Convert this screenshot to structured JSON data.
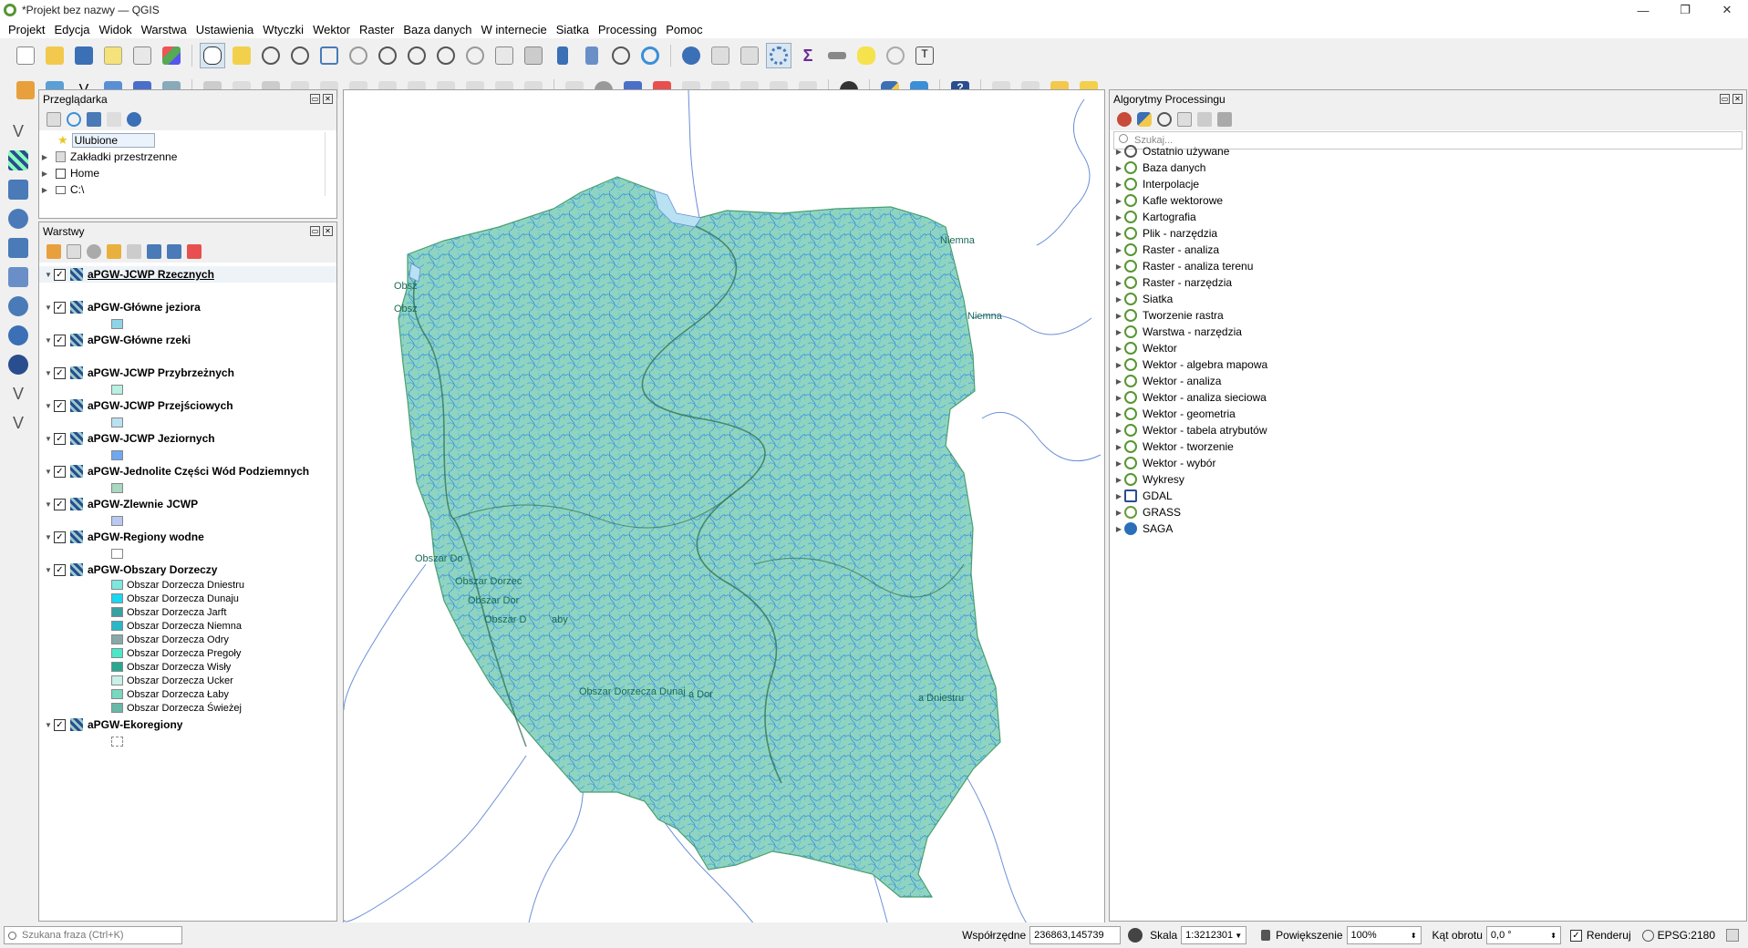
{
  "window": {
    "title": "*Projekt bez nazwy — QGIS",
    "controls": [
      "—",
      "❐",
      "✕"
    ]
  },
  "menu": [
    "Projekt",
    "Edycja",
    "Widok",
    "Warstwa",
    "Ustawienia",
    "Wtyczki",
    "Wektor",
    "Raster",
    "Baza danych",
    "W internecie",
    "Siatka",
    "Processing",
    "Pomoc"
  ],
  "browser": {
    "title": "Przeglądarka",
    "items": [
      {
        "label": "Ulubione",
        "icon": "star-icon"
      },
      {
        "label": "Zakładki przestrzenne",
        "icon": "bookmark-icon"
      },
      {
        "label": "Home",
        "icon": "home-folder-icon"
      },
      {
        "label": "C:\\",
        "icon": "drive-icon"
      }
    ]
  },
  "layers": {
    "title": "Warstwy",
    "list": [
      {
        "name": "aPGW-JCWP Rzecznych",
        "swatch": ""
      },
      {
        "name": "aPGW-Główne jeziora",
        "swatch": "#8fd3e8"
      },
      {
        "name": "aPGW-Główne rzeki",
        "swatch": ""
      },
      {
        "name": "aPGW-JCWP Przybrzeżnych",
        "swatch": "#b7efe2"
      },
      {
        "name": "aPGW-JCWP Przejściowych",
        "swatch": "#b8e2f2"
      },
      {
        "name": "aPGW-JCWP Jeziornych",
        "swatch": "#6fa8f0"
      },
      {
        "name": "aPGW-Jednolite Części Wód Podziemnych",
        "swatch": "#a9d7bf"
      },
      {
        "name": "aPGW-Zlewnie JCWP",
        "swatch": "#b8c8f0"
      },
      {
        "name": "aPGW-Regiony wodne",
        "swatch": "#ffffff"
      }
    ],
    "obszary": {
      "name": "aPGW-Obszary Dorzeczy",
      "classes": [
        {
          "label": "Obszar Dorzecza Dniestru",
          "color": "#7de8e0"
        },
        {
          "label": "Obszar Dorzecza Dunaju",
          "color": "#19d8f0"
        },
        {
          "label": "Obszar Dorzecza Jarft",
          "color": "#3aa0a0"
        },
        {
          "label": "Obszar Dorzecza Niemna",
          "color": "#28b8c8"
        },
        {
          "label": "Obszar Dorzecza Odry",
          "color": "#8aa8a8"
        },
        {
          "label": "Obszar Dorzecza Pregoły",
          "color": "#4ae8c8"
        },
        {
          "label": "Obszar Dorzecza Wisły",
          "color": "#28a890"
        },
        {
          "label": "Obszar Dorzecza Ucker",
          "color": "#c8f0e8"
        },
        {
          "label": "Obszar Dorzecza Łaby",
          "color": "#78d8c0"
        },
        {
          "label": "Obszar Dorzecza Świeżej",
          "color": "#68b8a8"
        }
      ]
    },
    "last": {
      "name": "aPGW-Ekoregiony"
    }
  },
  "map_labels": [
    "Niemna",
    "Niemna",
    "Obsz",
    "Obsz",
    "Obszar Do",
    "Obszar Dorzec",
    "Obszar Dor",
    "Obszar D",
    "aby",
    "Obszar Dorzecza Dunaj",
    "a Dor",
    "a Dniestru"
  ],
  "processing": {
    "title": "Algorytmy Processingu",
    "search_placeholder": "Szukaj...",
    "items": [
      {
        "label": "Ostatnio używane",
        "icon": "clock-icon"
      },
      {
        "label": "Baza danych",
        "icon": "qgis-icon"
      },
      {
        "label": "Interpolacje",
        "icon": "qgis-icon"
      },
      {
        "label": "Kafle wektorowe",
        "icon": "qgis-icon"
      },
      {
        "label": "Kartografia",
        "icon": "qgis-icon"
      },
      {
        "label": "Plik - narzędzia",
        "icon": "qgis-icon"
      },
      {
        "label": "Raster - analiza",
        "icon": "qgis-icon"
      },
      {
        "label": "Raster - analiza terenu",
        "icon": "qgis-icon"
      },
      {
        "label": "Raster - narzędzia",
        "icon": "qgis-icon"
      },
      {
        "label": "Siatka",
        "icon": "qgis-icon"
      },
      {
        "label": "Tworzenie rastra",
        "icon": "qgis-icon"
      },
      {
        "label": "Warstwa - narzędzia",
        "icon": "qgis-icon"
      },
      {
        "label": "Wektor",
        "icon": "qgis-icon"
      },
      {
        "label": "Wektor - algebra mapowa",
        "icon": "qgis-icon"
      },
      {
        "label": "Wektor - analiza",
        "icon": "qgis-icon"
      },
      {
        "label": "Wektor - analiza sieciowa",
        "icon": "qgis-icon"
      },
      {
        "label": "Wektor - geometria",
        "icon": "qgis-icon"
      },
      {
        "label": "Wektor - tabela atrybutów",
        "icon": "qgis-icon"
      },
      {
        "label": "Wektor - tworzenie",
        "icon": "qgis-icon"
      },
      {
        "label": "Wektor - wybór",
        "icon": "qgis-icon"
      },
      {
        "label": "Wykresy",
        "icon": "qgis-icon"
      },
      {
        "label": "GDAL",
        "icon": "gdal-icon"
      },
      {
        "label": "GRASS",
        "icon": "grass-icon"
      },
      {
        "label": "SAGA",
        "icon": "saga-icon"
      }
    ]
  },
  "status": {
    "locator_placeholder": "Szukana fraza (Ctrl+K)",
    "coord_label": "Współrzędne",
    "coord_value": "236863,145739",
    "scale_label": "Skala",
    "scale_value": "1:3212301",
    "magnifier_label": "Powiększenie",
    "magnifier_value": "100%",
    "rotation_label": "Kąt obrotu",
    "rotation_value": "0,0 °",
    "render_label": "Renderuj",
    "crs_label": "EPSG:2180"
  },
  "colors": {
    "map_fill": "#8fd4c0",
    "rivers": "#2a8ee8",
    "qgis_green": "#589632"
  }
}
